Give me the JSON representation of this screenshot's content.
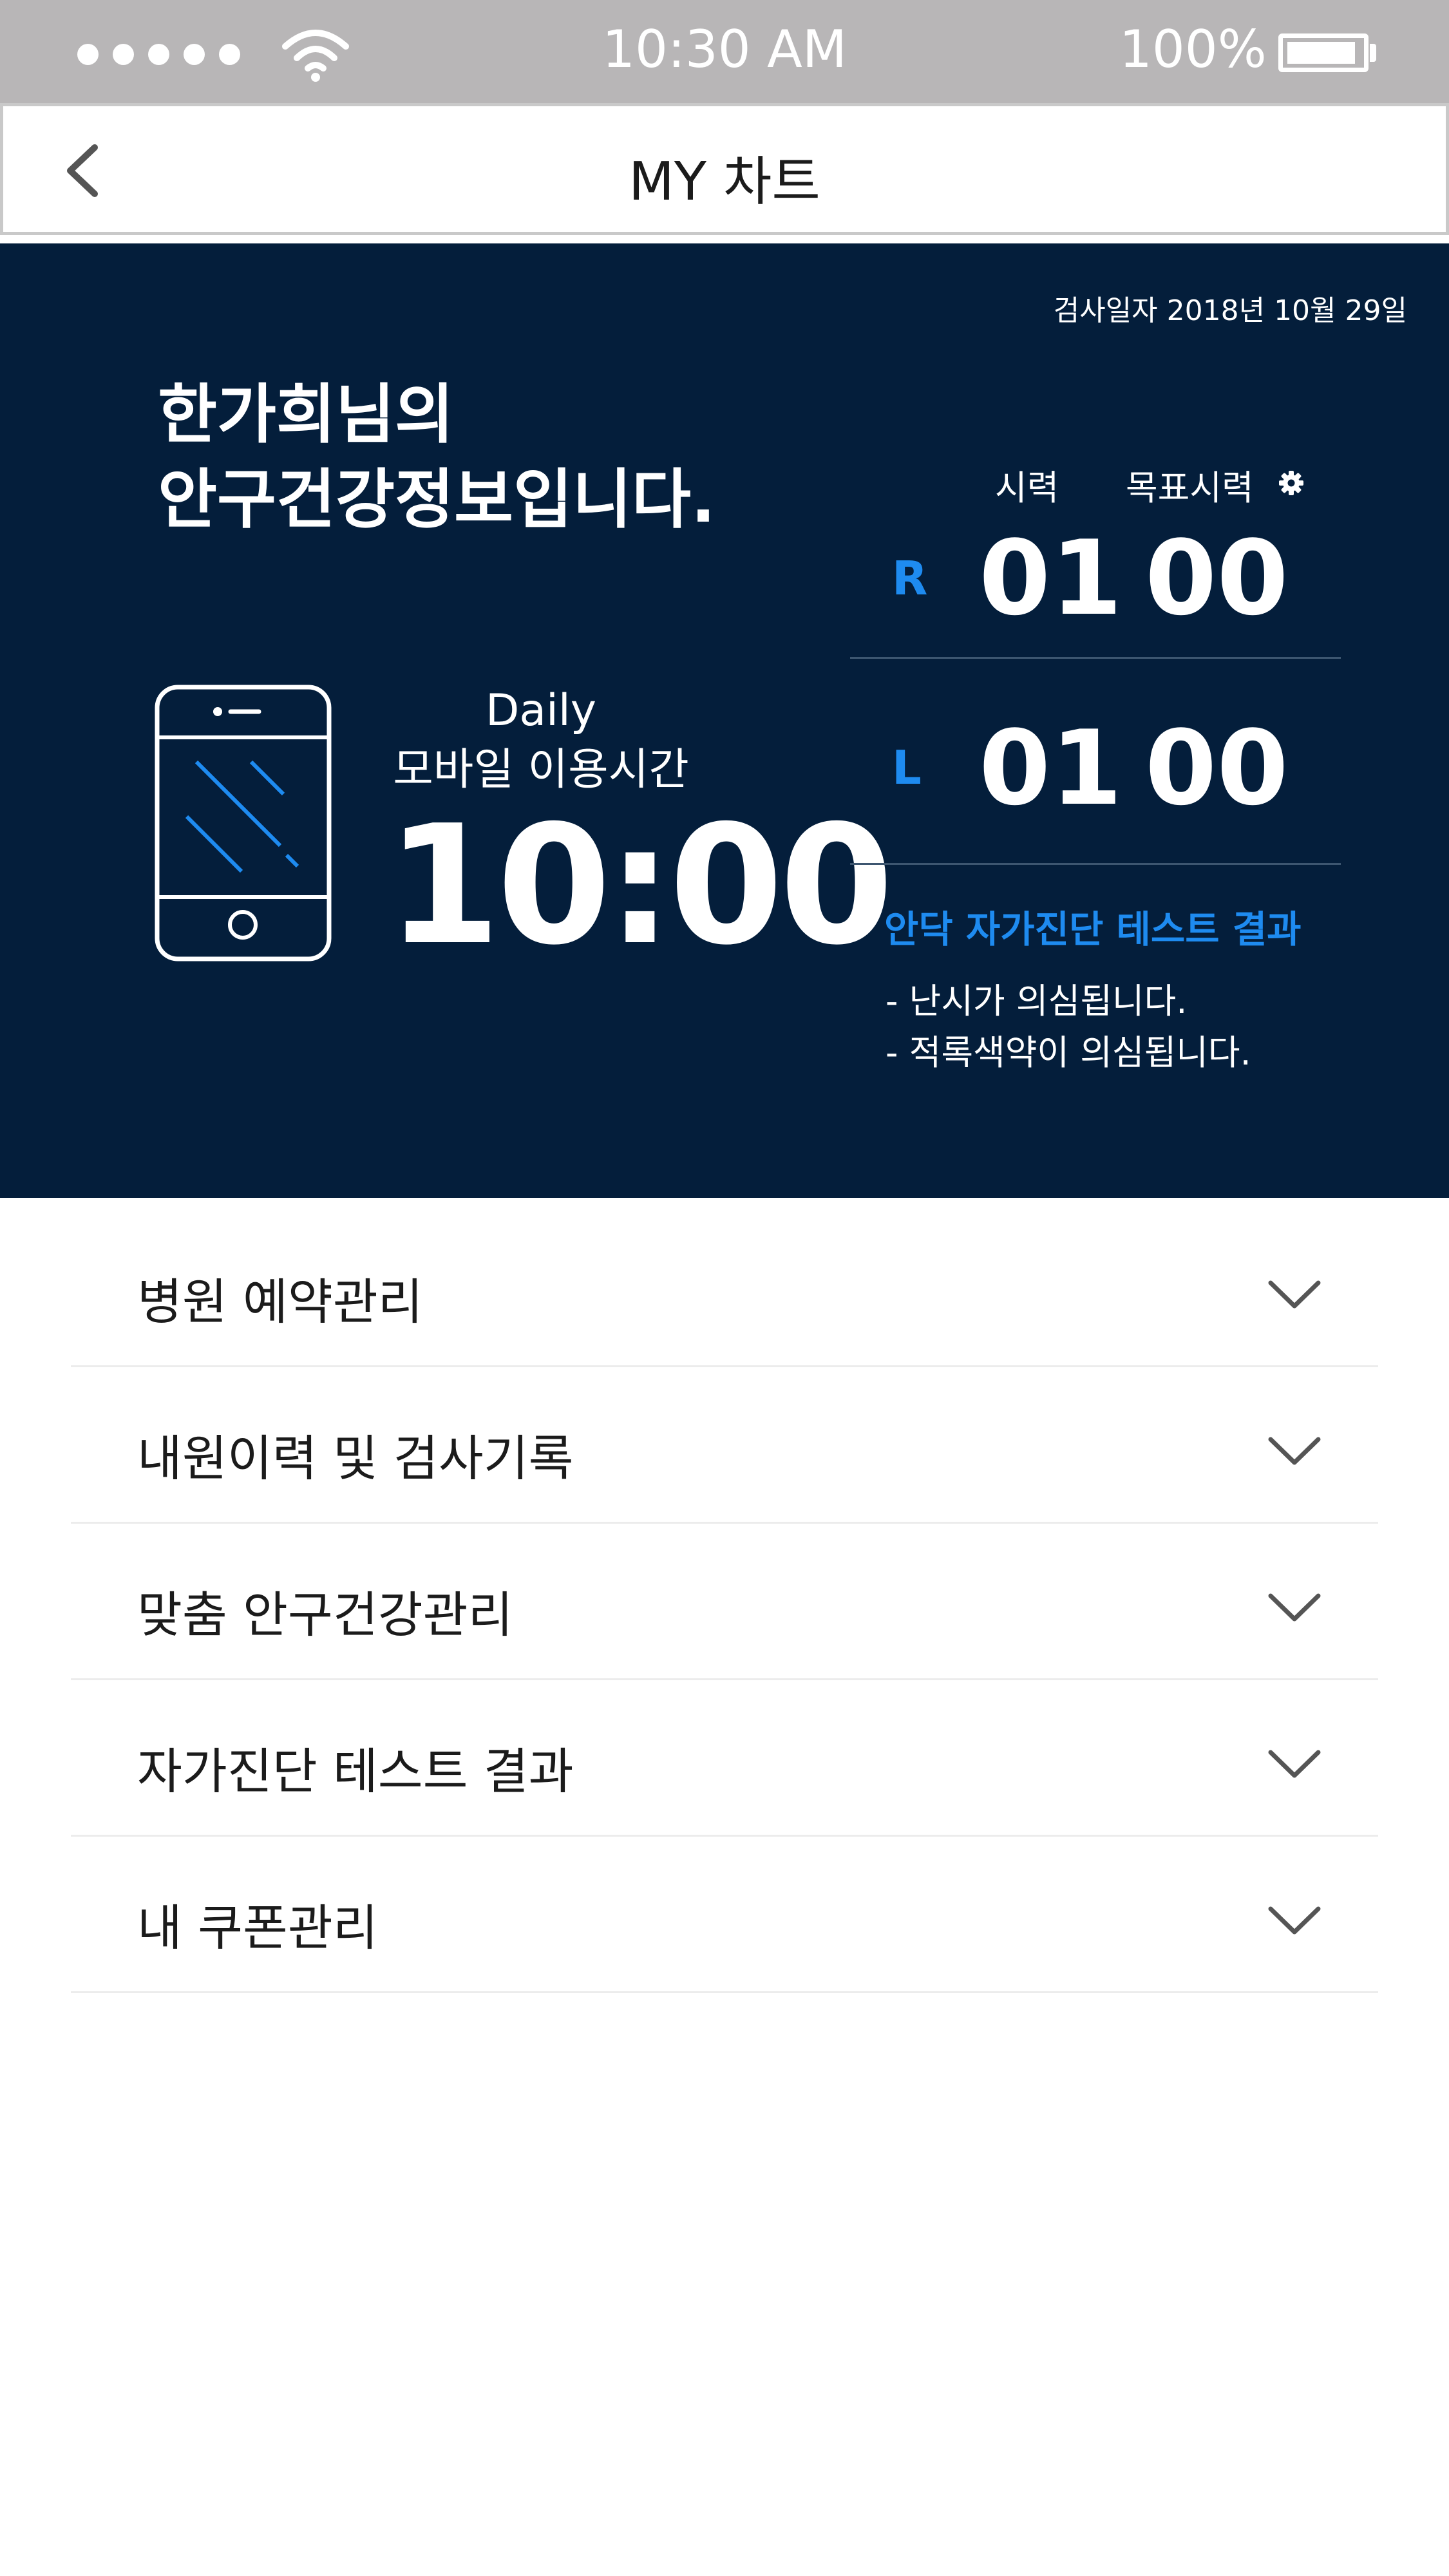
{
  "status_bar": {
    "time": "10:30 AM",
    "battery": "100%"
  },
  "nav": {
    "title": "MY 차트"
  },
  "dashboard": {
    "exam_date": "검사일자  2018년 10월 29일",
    "greeting_line1": "한가희님의",
    "greeting_line2": "안구건강정보입니다.",
    "usage": {
      "label_line1": "Daily",
      "label_line2": "모바일 이용시간",
      "time": "10:00"
    },
    "vision": {
      "current_label": "시력",
      "target_label": "목표시력",
      "right": {
        "eye": "R",
        "current": "01",
        "target": "00"
      },
      "left": {
        "eye": "L",
        "current": "01",
        "target": "00"
      }
    },
    "self_test": {
      "title": "안닥 자가진단 테스트 결과",
      "results": [
        "- 난시가 의심됩니다.",
        "- 적록색약이 의심됩니다."
      ]
    }
  },
  "menu": {
    "items": [
      {
        "label": "병원 예약관리"
      },
      {
        "label": "내원이력 및 검사기록"
      },
      {
        "label": "맞춤 안구건강관리"
      },
      {
        "label": "자가진단 테스트 결과"
      },
      {
        "label": "내 쿠폰관리"
      }
    ]
  },
  "colors": {
    "panel": "#041e3b",
    "accent": "#1e8bf0",
    "status_bar": "#b8b6b7"
  }
}
